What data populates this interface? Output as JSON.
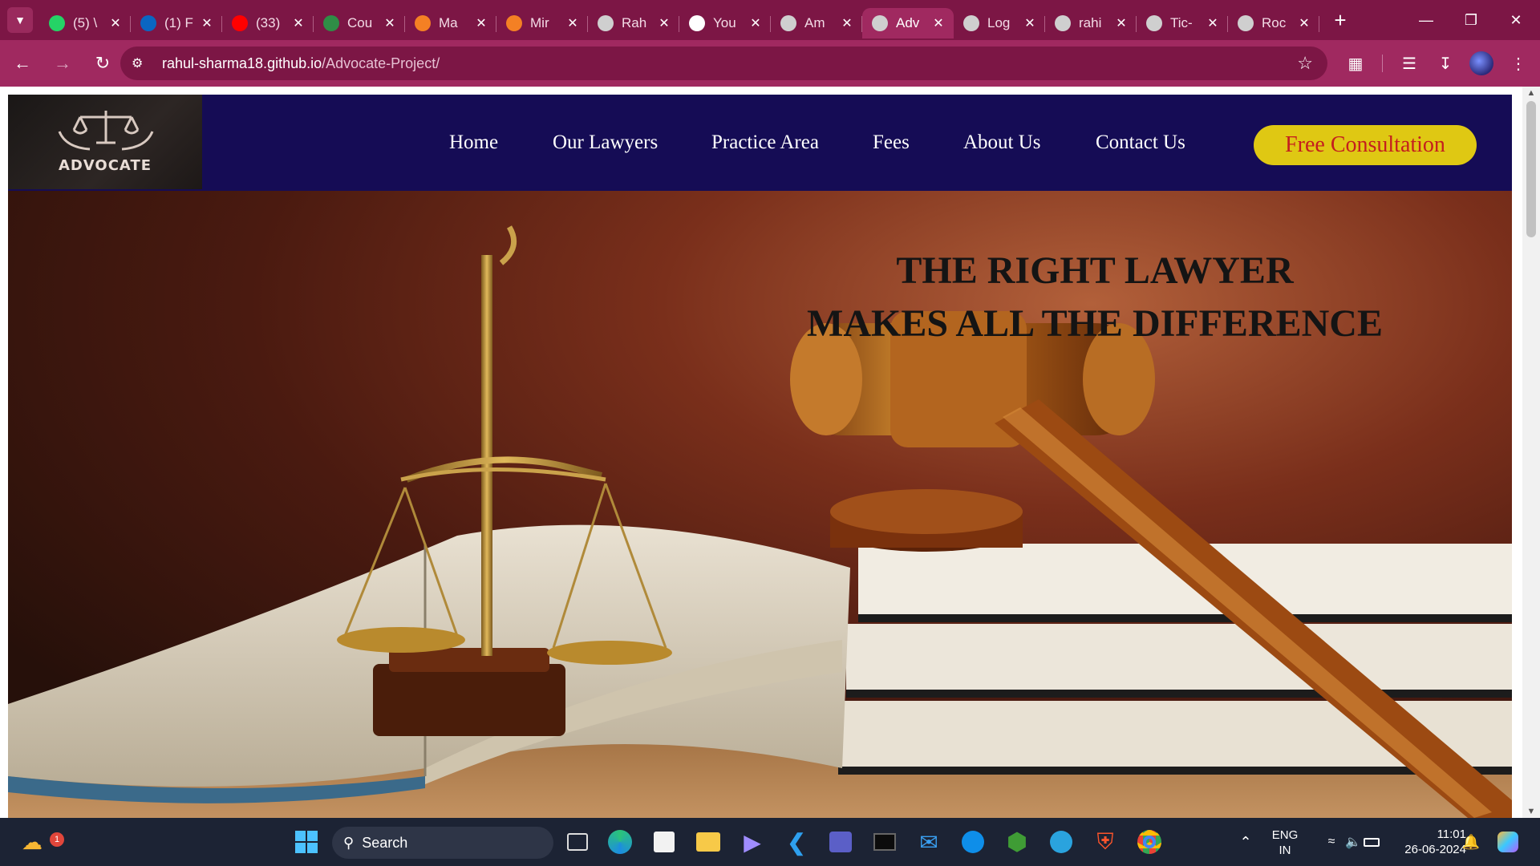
{
  "browser": {
    "tabs": [
      {
        "title": "(5) \\",
        "favicon": "whatsapp-icon",
        "color": "#25d366"
      },
      {
        "title": "(1) F",
        "favicon": "linkedin-icon",
        "color": "#0a66c2"
      },
      {
        "title": "(33)",
        "favicon": "youtube-icon",
        "color": "#ff0000"
      },
      {
        "title": "Cou",
        "favicon": "course-icon",
        "color": "#2f8d46"
      },
      {
        "title": "Ma",
        "favicon": "stack-icon",
        "color": "#f48024"
      },
      {
        "title": "Mir",
        "favicon": "stack-icon",
        "color": "#f48024"
      },
      {
        "title": "Rah",
        "favicon": "globe-icon",
        "color": "#cfcfcf"
      },
      {
        "title": "You",
        "favicon": "github-icon",
        "color": "#ffffff"
      },
      {
        "title": "Am",
        "favicon": "globe-icon",
        "color": "#cfcfcf"
      },
      {
        "title": "Adv",
        "favicon": "globe-icon",
        "color": "#cfcfcf",
        "active": true
      },
      {
        "title": "Log",
        "favicon": "globe-icon",
        "color": "#cfcfcf"
      },
      {
        "title": "rahi",
        "favicon": "globe-icon",
        "color": "#cfcfcf"
      },
      {
        "title": "Tic-",
        "favicon": "globe-icon",
        "color": "#cfcfcf"
      },
      {
        "title": "Roc",
        "favicon": "globe-icon",
        "color": "#cfcfcf"
      }
    ],
    "url_host": "rahul-sharma18.github.io",
    "url_path": "/Advocate-Project/"
  },
  "site": {
    "logo_text": "ADVOCATE",
    "nav": {
      "home": "Home",
      "lawyers": "Our Lawyers",
      "practice": "Practice Area",
      "fees": "Fees",
      "about": "About Us",
      "contact": "Contact Us",
      "cta": "Free Consultation"
    },
    "hero": {
      "line1": "THE RIGHT LAWYER",
      "line2": "MAKES ALL THE DIFFERENCE"
    },
    "colors": {
      "nav_bg": "#150c55",
      "cta_bg": "#dfc813",
      "cta_text": "#c41e1e"
    }
  },
  "taskbar": {
    "search_label": "Search",
    "notification_count": "1",
    "lang_line1": "ENG",
    "lang_line2": "IN",
    "time": "11:01",
    "date": "26-06-2024"
  }
}
